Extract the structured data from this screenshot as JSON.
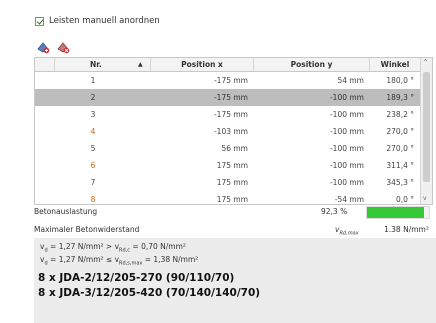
{
  "options": {
    "manual_label": "Leisten manuell anordnen",
    "checked": true
  },
  "toolbar": {
    "icons": [
      "add-row-icon",
      "delete-row-icon"
    ]
  },
  "table": {
    "headers": {
      "nr": "Nr.",
      "x": "Position x",
      "y": "Position y",
      "winkel": "Winkel"
    },
    "sort_indicator": "▲",
    "rows": [
      {
        "nr": "1",
        "x": "-175 mm",
        "y": "54 mm",
        "w": "180,0 °"
      },
      {
        "nr": "2",
        "x": "-175 mm",
        "y": "-100 mm",
        "w": "189,3 °",
        "selected": true
      },
      {
        "nr": "3",
        "x": "-175 mm",
        "y": "-100 mm",
        "w": "238,2 °"
      },
      {
        "nr": "4",
        "x": "-103 mm",
        "y": "-100 mm",
        "w": "270,0 °"
      },
      {
        "nr": "5",
        "x": "56 mm",
        "y": "-100 mm",
        "w": "270,0 °"
      },
      {
        "nr": "6",
        "x": "175 mm",
        "y": "-100 mm",
        "w": "311,4 °"
      },
      {
        "nr": "7",
        "x": "175 mm",
        "y": "-100 mm",
        "w": "345,3 °"
      },
      {
        "nr": "8",
        "x": "175 mm",
        "y": "-54 mm",
        "w": "0,0 °"
      }
    ]
  },
  "stats": {
    "betonauslastung_label": "Betonauslastung",
    "betonauslastung_value": "92,3 %",
    "betonauslastung_fraction": 0.923,
    "widerstand_label": "Maximaler Betonwiderstand",
    "widerstand_symbol": "v",
    "widerstand_symbol_sub": "Rd,max",
    "widerstand_value": "1.38 N/mm²"
  },
  "info": {
    "line1": {
      "a": "v",
      "a_sub": "d",
      "b": " = 1,27 N/mm² > v",
      "b_sub": "Rd,c",
      "c": " = 0,70 N/mm²"
    },
    "line2": {
      "a": "v",
      "a_sub": "d",
      "b": " = 1,27 N/mm² ≤ v",
      "b_sub": "Rd,s,max",
      "c": " = 1,38 N/mm²"
    },
    "result1": "8 x JDA-2/12/205-270 (90/110/70)",
    "result2": "8 x JDA-3/12/205-420 (70/140/140/70)"
  },
  "colors": {
    "selected_row": "#bdbdbd",
    "odd_nr_orange": "#c86418",
    "bar_green": "#37c837",
    "info_bg": "#ececec"
  }
}
